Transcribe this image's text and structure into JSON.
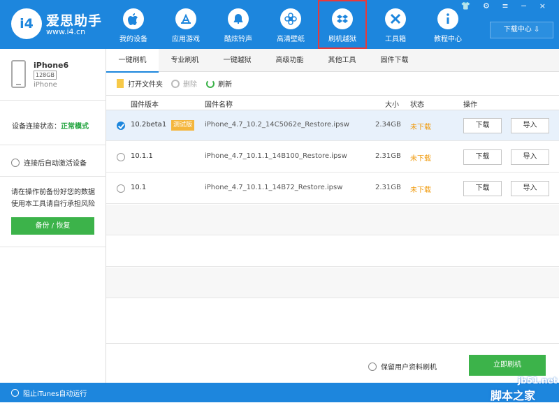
{
  "brand": {
    "logo_text": "i4",
    "name": "爱思助手",
    "url": "www.i4.cn"
  },
  "nav": [
    {
      "label": "我的设备",
      "icon": "apple-icon"
    },
    {
      "label": "应用游戏",
      "icon": "app-store-icon"
    },
    {
      "label": "酷炫铃声",
      "icon": "bell-icon"
    },
    {
      "label": "高清壁纸",
      "icon": "flower-icon"
    },
    {
      "label": "刷机越狱",
      "icon": "dropbox-icon",
      "active": true
    },
    {
      "label": "工具箱",
      "icon": "tools-icon"
    },
    {
      "label": "教程中心",
      "icon": "info-icon"
    }
  ],
  "window_controls": "👕 ⚙ ≡ − ×",
  "download_center": "下载中心 ⇩",
  "device": {
    "name": "iPhone6",
    "capacity": "128GB",
    "type": "iPhone"
  },
  "sidebar": {
    "conn_label": "设备连接状态：",
    "conn_value": "正常模式",
    "auto_activate": "连接后自动激活设备",
    "warning": "请在操作前备份好您的数据 使用本工具请自行承担风险",
    "backup_button": "备份 / 恢复"
  },
  "footer": {
    "itunes_label": "阻止iTunes自动运行"
  },
  "tabs": [
    "一键刷机",
    "专业刷机",
    "一键越狱",
    "高级功能",
    "其他工具",
    "固件下载"
  ],
  "toolbar": {
    "open_folder": "打开文件夹",
    "delete": "删除",
    "refresh": "刷新"
  },
  "table": {
    "headers": {
      "version": "固件版本",
      "name": "固件名称",
      "size": "大小",
      "status": "状态",
      "action": "操作"
    },
    "rows": [
      {
        "version": "10.2beta1",
        "badge": "测试版",
        "name": "iPhone_4.7_10.2_14C5062e_Restore.ipsw",
        "size": "2.34GB",
        "status": "未下载",
        "download": "下载",
        "import": "导入",
        "selected": true
      },
      {
        "version": "10.1.1",
        "badge": "",
        "name": "iPhone_4.7_10.1.1_14B100_Restore.ipsw",
        "size": "2.31GB",
        "status": "未下载",
        "download": "下载",
        "import": "导入",
        "selected": false
      },
      {
        "version": "10.1",
        "badge": "",
        "name": "iPhone_4.7_10.1.1_14B72_Restore.ipsw",
        "size": "2.31GB",
        "status": "未下载",
        "download": "下载",
        "import": "导入",
        "selected": false
      }
    ]
  },
  "bottom": {
    "keep_data": "保留用户资料刷机",
    "flash_button": "立即刷机"
  },
  "watermark": {
    "site": "jb51.net",
    "cn": "脚本之家"
  },
  "colors": {
    "primary": "#1d86dd",
    "success": "#3cb34a",
    "warning": "#f09a0c",
    "badge": "#f4b63c",
    "highlight": "#e8393a"
  }
}
